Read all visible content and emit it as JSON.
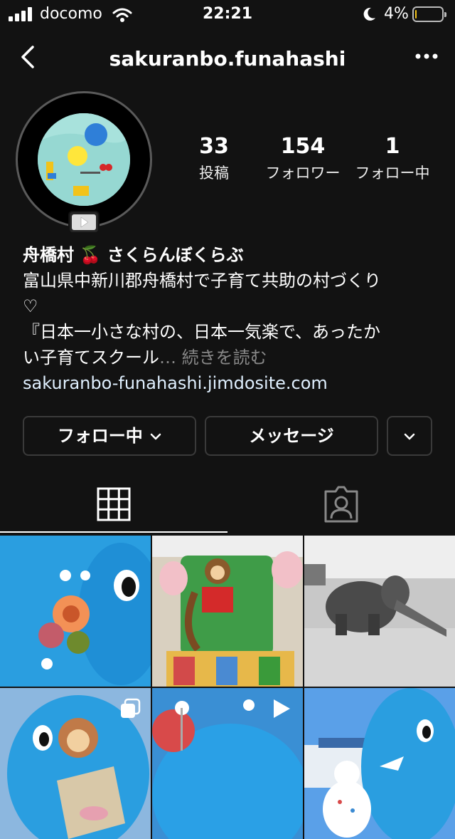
{
  "status_bar": {
    "carrier": "docomo",
    "time": "22:21",
    "battery": "4%",
    "battery_level": 0.04
  },
  "header": {
    "username": "sakuranbo.funahashi"
  },
  "stats": {
    "posts": {
      "count": "33",
      "label": "投稿"
    },
    "followers": {
      "count": "154",
      "label": "フォロワー"
    },
    "following": {
      "count": "1",
      "label": "フォロー中"
    }
  },
  "bio": {
    "name": "舟橋村",
    "name_emoji": "🍒",
    "name_suffix": "さくらんぼくらぶ",
    "line1": "富山県中新川郡舟橋村で子育て共助の村づくり",
    "heart": "♡",
    "line2": "『日本一小さな村の、日本一気楽で、あったか",
    "line3": "い子育てスクール",
    "more_label": "… 続きを読む",
    "website": "sakuranbo-funahashi.jimdosite.com"
  },
  "actions": {
    "following_label": "フォロー中",
    "message_label": "メッセージ"
  },
  "tabs": [
    {
      "name": "grid",
      "icon": "grid-icon"
    },
    {
      "name": "tagged",
      "icon": "tagged-person-icon"
    }
  ],
  "colors": {
    "background": "#121212",
    "tab_indicator": "#ffffff",
    "button_border": "#3a3a3a"
  }
}
